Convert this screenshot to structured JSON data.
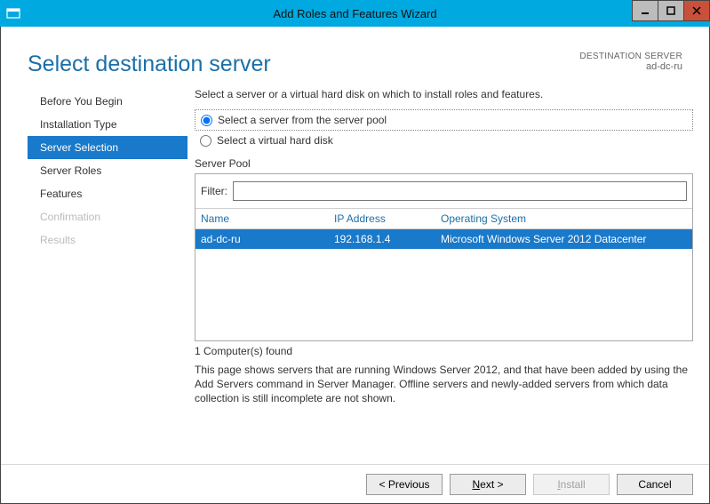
{
  "window": {
    "title": "Add Roles and Features Wizard"
  },
  "header": {
    "page_title": "Select destination server",
    "dest_label": "DESTINATION SERVER",
    "dest_value": "ad-dc-ru"
  },
  "sidebar": {
    "items": [
      {
        "label": "Before You Begin",
        "state": ""
      },
      {
        "label": "Installation Type",
        "state": ""
      },
      {
        "label": "Server Selection",
        "state": "active"
      },
      {
        "label": "Server Roles",
        "state": ""
      },
      {
        "label": "Features",
        "state": ""
      },
      {
        "label": "Confirmation",
        "state": "disabled"
      },
      {
        "label": "Results",
        "state": "disabled"
      }
    ]
  },
  "main": {
    "intro": "Select a server or a virtual hard disk on which to install roles and features.",
    "radio1": "Select a server from the server pool",
    "radio2": "Select a virtual hard disk",
    "pool_label": "Server Pool",
    "filter_label": "Filter:",
    "filter_value": "",
    "columns": {
      "name": "Name",
      "ip": "IP Address",
      "os": "Operating System"
    },
    "rows": [
      {
        "name": "ad-dc-ru",
        "ip": "192.168.1.4",
        "os": "Microsoft Windows Server 2012 Datacenter",
        "selected": true
      }
    ],
    "found": "1 Computer(s) found",
    "hint": "This page shows servers that are running Windows Server 2012, and that have been added by using the Add Servers command in Server Manager. Offline servers and newly-added servers from which data collection is still incomplete are not shown."
  },
  "footer": {
    "previous": "< Previous",
    "next_prefix": "N",
    "next_rest": "ext >",
    "install_prefix": "I",
    "install_rest": "nstall",
    "cancel": "Cancel"
  }
}
